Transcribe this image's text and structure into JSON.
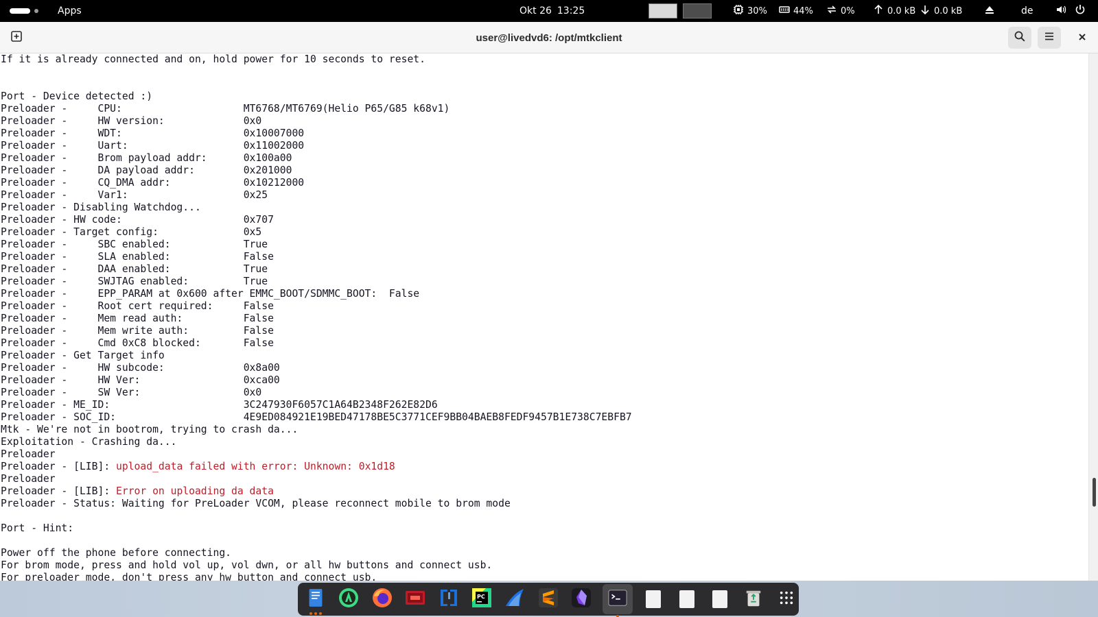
{
  "topbar": {
    "apps_label": "Apps",
    "date": "Okt 26",
    "time": "13:25",
    "cpu": "30%",
    "memory": "44%",
    "swap": "0%",
    "net_up": "0.0 kB",
    "net_down": "0.0 kB",
    "keyboard_layout": "de",
    "swatch_light": "#d9d9d9",
    "swatch_dark": "#4d4d4d"
  },
  "window": {
    "title": "user@livedvd6: /opt/mtkclient"
  },
  "terminal": {
    "lines": [
      {
        "text": "If it is already connected and on, hold power for 10 seconds to reset."
      },
      {
        "text": ""
      },
      {
        "text": ""
      },
      {
        "text": "Port - Device detected :)"
      },
      {
        "text": "Preloader -     CPU:                    MT6768/MT6769(Helio P65/G85 k68v1)"
      },
      {
        "text": "Preloader -     HW version:             0x0"
      },
      {
        "text": "Preloader -     WDT:                    0x10007000"
      },
      {
        "text": "Preloader -     Uart:                   0x11002000"
      },
      {
        "text": "Preloader -     Brom payload addr:      0x100a00"
      },
      {
        "text": "Preloader -     DA payload addr:        0x201000"
      },
      {
        "text": "Preloader -     CQ_DMA addr:            0x10212000"
      },
      {
        "text": "Preloader -     Var1:                   0x25"
      },
      {
        "text": "Preloader - Disabling Watchdog..."
      },
      {
        "text": "Preloader - HW code:                    0x707"
      },
      {
        "text": "Preloader - Target config:              0x5"
      },
      {
        "text": "Preloader -     SBC enabled:            True"
      },
      {
        "text": "Preloader -     SLA enabled:            False"
      },
      {
        "text": "Preloader -     DAA enabled:            True"
      },
      {
        "text": "Preloader -     SWJTAG enabled:         True"
      },
      {
        "text": "Preloader -     EPP_PARAM at 0x600 after EMMC_BOOT/SDMMC_BOOT:  False"
      },
      {
        "text": "Preloader -     Root cert required:     False"
      },
      {
        "text": "Preloader -     Mem read auth:          False"
      },
      {
        "text": "Preloader -     Mem write auth:         False"
      },
      {
        "text": "Preloader -     Cmd 0xC8 blocked:       False"
      },
      {
        "text": "Preloader - Get Target info"
      },
      {
        "text": "Preloader -     HW subcode:             0x8a00"
      },
      {
        "text": "Preloader -     HW Ver:                 0xca00"
      },
      {
        "text": "Preloader -     SW Ver:                 0x0"
      },
      {
        "text": "Preloader - ME_ID:                      3C247930F6057C1A64B2348F262E82D6"
      },
      {
        "text": "Preloader - SOC_ID:                     4E9ED084921E19BED47178BE5C3771CEF9BB04BAEB8FEDF9457B1E738C7EBFB7"
      },
      {
        "text": "Mtk - We're not in bootrom, trying to crash da..."
      },
      {
        "text": "Exploitation - Crashing da..."
      },
      {
        "text": "Preloader"
      },
      {
        "text": "Preloader - [LIB]: ",
        "error": "upload_data failed with error: Unknown: 0x1d18"
      },
      {
        "text": "Preloader"
      },
      {
        "text": "Preloader - [LIB]: ",
        "error": "Error on uploading da data"
      },
      {
        "text": "Preloader - Status: Waiting for PreLoader VCOM, please reconnect mobile to brom mode"
      },
      {
        "text": ""
      },
      {
        "text": "Port - Hint:"
      },
      {
        "text": ""
      },
      {
        "text": "Power off the phone before connecting."
      },
      {
        "text": "For brom mode, press and hold vol up, vol dwn, or all hw buttons and connect usb."
      },
      {
        "text": "For preloader mode, don't press any hw button and connect usb."
      }
    ],
    "error_color": "#c01c28",
    "scroll_position": 0.85
  },
  "dock": {
    "items": [
      {
        "name": "files",
        "running": true
      },
      {
        "name": "android-studio"
      },
      {
        "name": "firefox"
      },
      {
        "name": "dvd-app"
      },
      {
        "name": "code-editor"
      },
      {
        "name": "pycharm"
      },
      {
        "name": "wireshark"
      },
      {
        "name": "sublime-text"
      },
      {
        "name": "obsidian"
      },
      {
        "name": "terminal",
        "active": true,
        "running": true
      },
      {
        "name": "document-1"
      },
      {
        "name": "document-2"
      },
      {
        "name": "document-3"
      },
      {
        "name": "trash"
      },
      {
        "name": "show-apps"
      }
    ]
  }
}
